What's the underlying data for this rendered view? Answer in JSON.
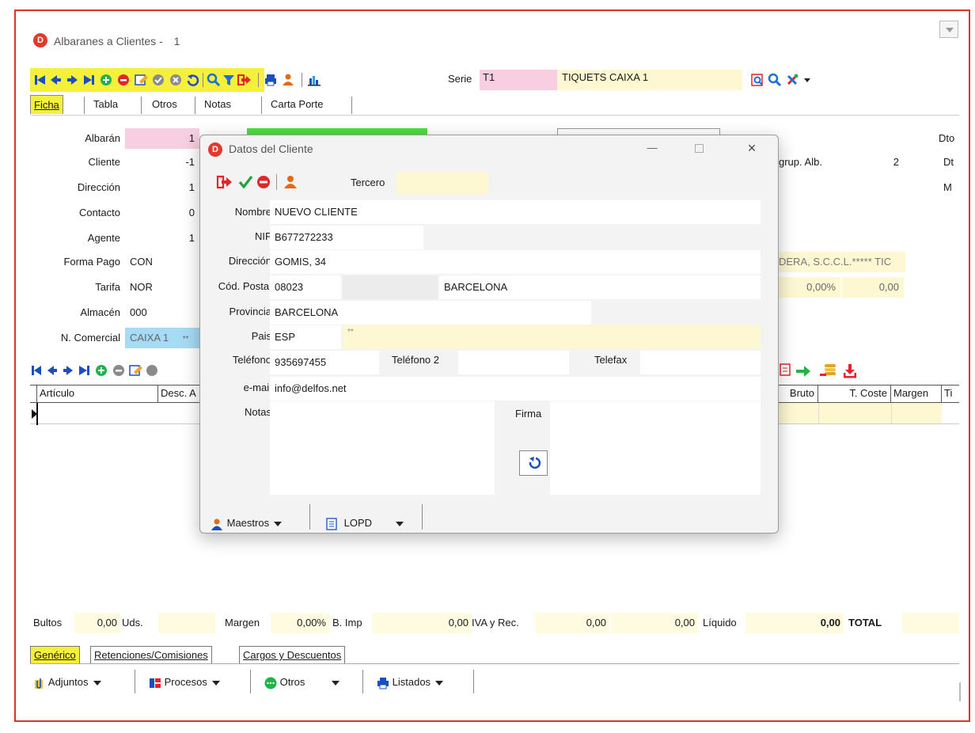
{
  "window": {
    "title": "Albaranes a Clientes -",
    "number": "1",
    "logo_letter": "D",
    "accent": "#e03a2c"
  },
  "toolbar": {
    "serie_label": "Serie",
    "serie_value": "T1",
    "serie_desc": "TIQUETS CAIXA 1"
  },
  "tabs": [
    {
      "label": "Ficha"
    },
    {
      "label": "Tabla"
    },
    {
      "label": "Otros"
    },
    {
      "label": "Notas"
    },
    {
      "label": "Carta Porte"
    }
  ],
  "form": {
    "albaran_label": "Albarán",
    "albaran_value": "1",
    "cliente_label": "Cliente",
    "cliente_value": "-1",
    "direccion_label": "Dirección",
    "direccion_value": "1",
    "contacto_label": "Contacto",
    "contacto_value": "0",
    "agente_label": "Agente",
    "agente_value": "1",
    "forma_pago_label": "Forma Pago",
    "forma_pago_value": "CON",
    "tarifa_label": "Tarifa",
    "tarifa_value": "NOR",
    "almacen_label": "Almacén",
    "almacen_value": "000",
    "n_comercial_label": "N. Comercial",
    "n_comercial_value": "CAIXA 1",
    "n_comercial_extra": "**",
    "agrup_label": "grup. Alb.",
    "agrup_value": "2",
    "right_dto1": "Dto",
    "right_dto2": "Dt",
    "right_m": "M",
    "company_text": "DERA, S.C.C.L.***** TIC",
    "pct_value": "0,00%",
    "amount_value": "0,00"
  },
  "grid": {
    "headers": [
      "Artículo",
      "Desc. A",
      "Bruto",
      "T. Coste",
      "Margen",
      "Ti"
    ]
  },
  "totals": {
    "bultos_label": "Bultos",
    "bultos_value": "0,00",
    "uds_label": "Uds.",
    "margen_label": "Margen",
    "margen_value": "0,00%",
    "bimp_label": "B. Imp",
    "bimp_value": "0,00",
    "iva_label": "IVA y Rec.",
    "iva_value": "0,00",
    "rec_value": "0,00",
    "liquido_label": "Líquido",
    "liquido_value": "0,00",
    "total_label": "TOTAL"
  },
  "bottom_tabs": [
    {
      "label": "Genérico"
    },
    {
      "label": "Retenciones/Comisiones"
    },
    {
      "label": "Cargos y Descuentos"
    }
  ],
  "bottom_buttons": [
    {
      "label": "Adjuntos",
      "icon": "paperclip-icon"
    },
    {
      "label": "Procesos",
      "icon": "process-icon"
    },
    {
      "label": "Otros",
      "icon": "dots-icon"
    },
    {
      "label": "Listados",
      "icon": "printer-icon"
    }
  ],
  "dialog": {
    "title": "Datos del Cliente",
    "tercero_label": "Tercero",
    "tercero_value": "",
    "nombre_label": "Nombre",
    "nombre_value": "NUEVO CLIENTE",
    "nif_label": "NIF",
    "nif_value": "B677272233",
    "direccion_label": "Dirección",
    "direccion_value": "GOMIS, 34",
    "cp_label": "Cód. Postal",
    "cp_value": "08023",
    "city_value": "BARCELONA",
    "provincia_label": "Provincia",
    "provincia_value": "BARCELONA",
    "pais_label": "Pais",
    "pais_value": "ESP",
    "pais_extra": "**",
    "telefono_label": "Teléfono",
    "telefono_value": "935697455",
    "telefono2_label": "Teléfono 2",
    "telefono2_value": "",
    "telefax_label": "Telefax",
    "telefax_value": "",
    "email_label": "e-mail",
    "email_value": "info@delfos.net",
    "notas_label": "Notas",
    "firma_label": "Firma",
    "maestros_label": "Maestros",
    "lopd_label": "LOPD"
  },
  "colors": {
    "pink_field": "#f7cfe0",
    "yellow_field": "#fdf8d2",
    "toolbar_yellow": "#f5f03c",
    "green_state": "#4be03c",
    "blue_field": "#a6dbf5"
  }
}
